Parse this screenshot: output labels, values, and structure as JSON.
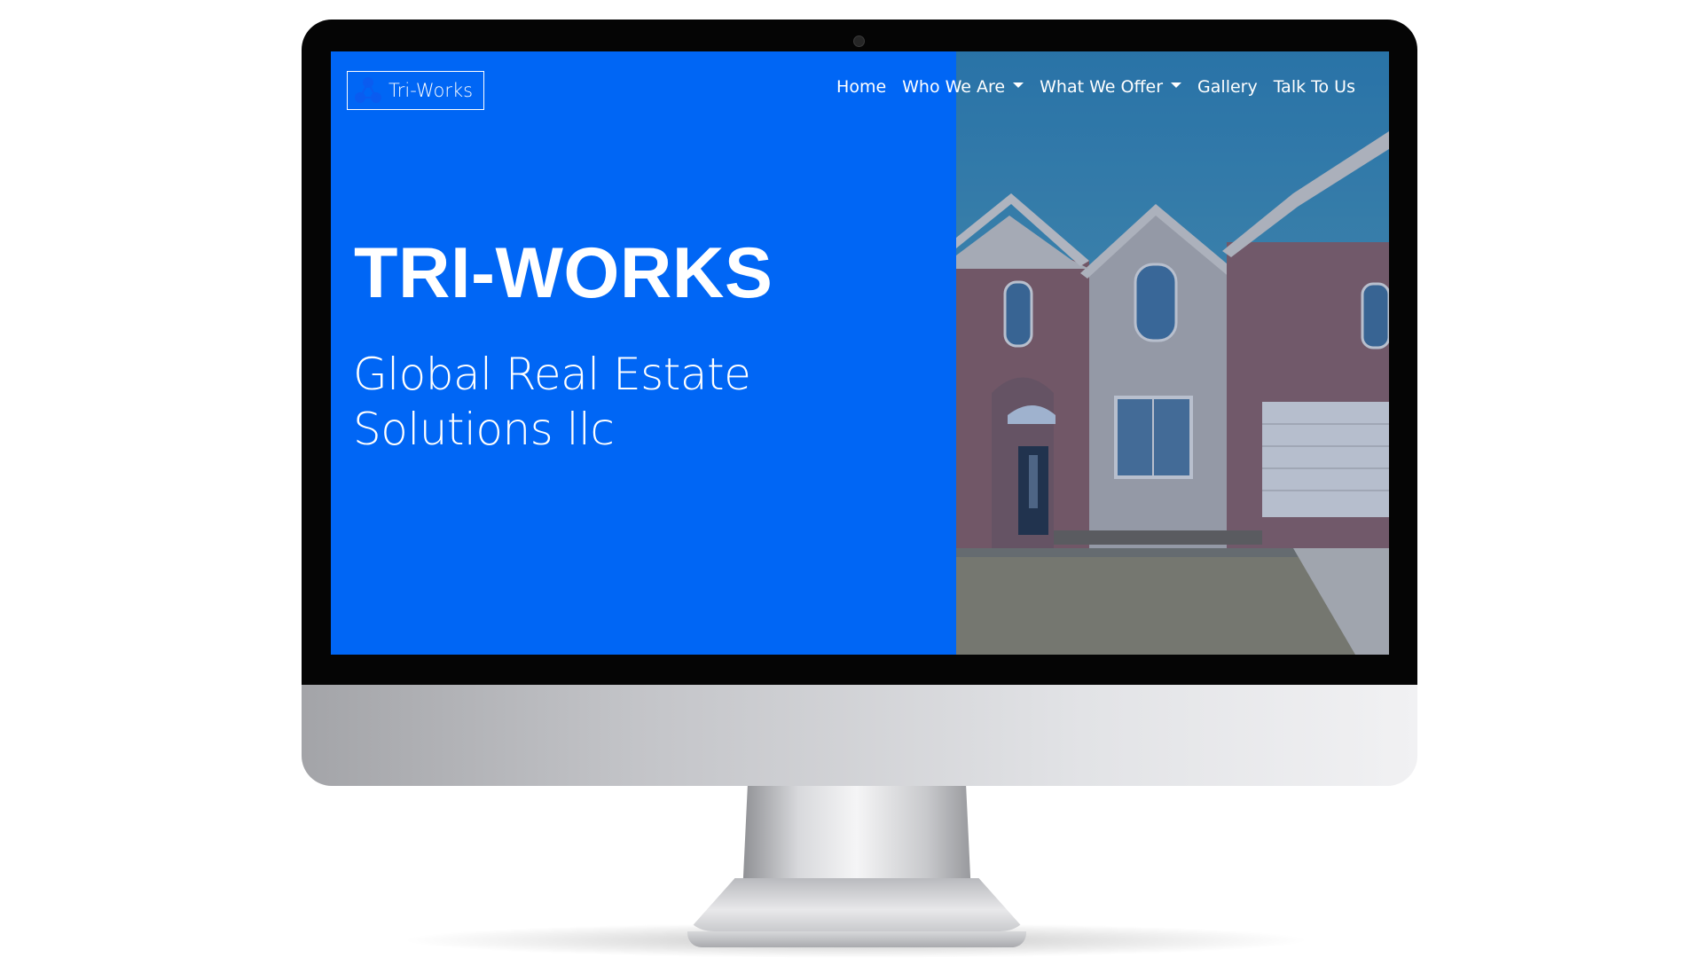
{
  "brand": {
    "name": "Tri-Works",
    "logo_icon": "tri-node-logo-icon",
    "logo_color": "#0a5cf0"
  },
  "nav": {
    "items": [
      {
        "label": "Home",
        "dropdown": false
      },
      {
        "label": "Who We Are",
        "dropdown": true
      },
      {
        "label": "What We Offer",
        "dropdown": true
      },
      {
        "label": "Gallery",
        "dropdown": false
      },
      {
        "label": "Talk To Us",
        "dropdown": false
      }
    ]
  },
  "hero": {
    "title": "TRI-WORKS",
    "subtitle": "Global Real Estate Solutions llc",
    "background_color": "#0066f5",
    "image": "brick-house-photo"
  },
  "device": {
    "type": "desktop-monitor-mockup"
  }
}
